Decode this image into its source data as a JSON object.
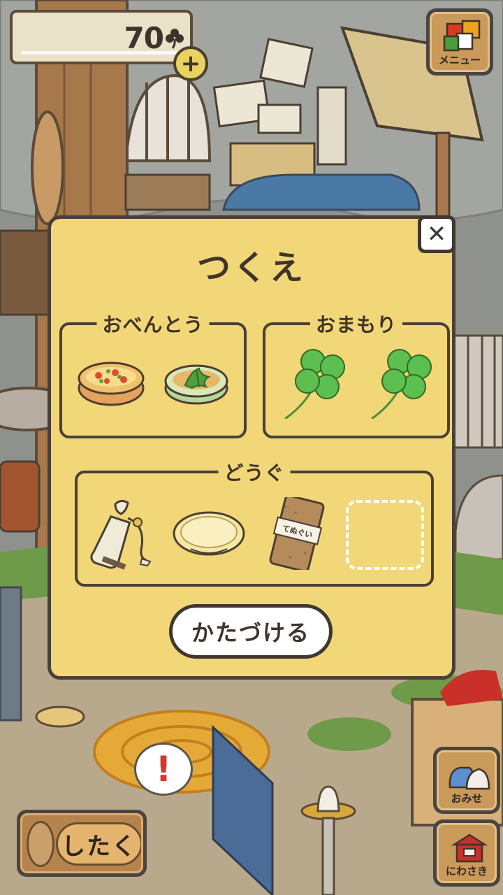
{
  "hud": {
    "clover_count": "70",
    "plus_label": "+",
    "menu_label": "メニュー",
    "shop_label": "おみせ",
    "garden_label": "にわさき",
    "prepare_label": "したく",
    "notice_mark": "!"
  },
  "dialog": {
    "title": "つくえ",
    "close_label": "✕",
    "lunch_section": {
      "label": "おべんとう",
      "items": [
        "quiche",
        "herb-cake"
      ]
    },
    "charm_section": {
      "label": "おまもり",
      "items": [
        "four-leaf-clover",
        "four-leaf-clover"
      ]
    },
    "tools_section": {
      "label": "どうぐ",
      "items": [
        "canteen-bag",
        "glass-plate",
        "tenugui-towel",
        "empty-slot"
      ],
      "towel_text": "てぬぐい"
    },
    "put_away_label": "かたづける"
  },
  "colors": {
    "dialog_bg": "#f1d777",
    "border": "#4b4037",
    "notice_red": "#d7372b",
    "clover_green": "#5cbf4f"
  }
}
